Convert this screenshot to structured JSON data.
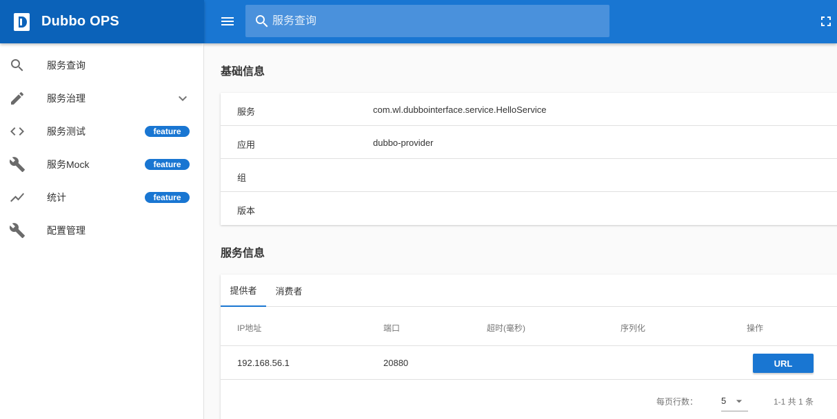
{
  "brand": {
    "title": "Dubbo OPS"
  },
  "search": {
    "placeholder": "服务查询"
  },
  "sidebar": {
    "items": [
      {
        "label": "服务查询",
        "icon": "search-icon"
      },
      {
        "label": "服务治理",
        "icon": "pencil-icon",
        "expandable": true
      },
      {
        "label": "服务测试",
        "icon": "code-icon",
        "badge": "feature"
      },
      {
        "label": "服务Mock",
        "icon": "wrench-icon",
        "badge": "feature"
      },
      {
        "label": "统计",
        "icon": "trending-icon",
        "badge": "feature"
      },
      {
        "label": "配置管理",
        "icon": "wrench-icon"
      }
    ]
  },
  "basic_info": {
    "title": "基础信息",
    "rows": [
      {
        "label": "服务",
        "value": "com.wl.dubbointerface.service.HelloService"
      },
      {
        "label": "应用",
        "value": "dubbo-provider"
      },
      {
        "label": "组",
        "value": ""
      },
      {
        "label": "版本",
        "value": ""
      }
    ]
  },
  "service_info": {
    "title": "服务信息",
    "tabs": [
      "提供者",
      "消费者"
    ],
    "active_tab": "提供者",
    "columns": [
      "IP地址",
      "端口",
      "超时(毫秒)",
      "序列化",
      "操作"
    ],
    "rows": [
      {
        "ip": "192.168.56.1",
        "port": "20880",
        "timeout": "",
        "serialization": "",
        "action": "URL"
      }
    ],
    "footer": {
      "rows_per_page_label": "每页行数：",
      "rows_per_page": "5",
      "page_info": "1-1 共 1 条"
    }
  },
  "colors": {
    "brand": "#0b62b9",
    "topbar": "#1976d2",
    "accent": "#1976d2"
  }
}
